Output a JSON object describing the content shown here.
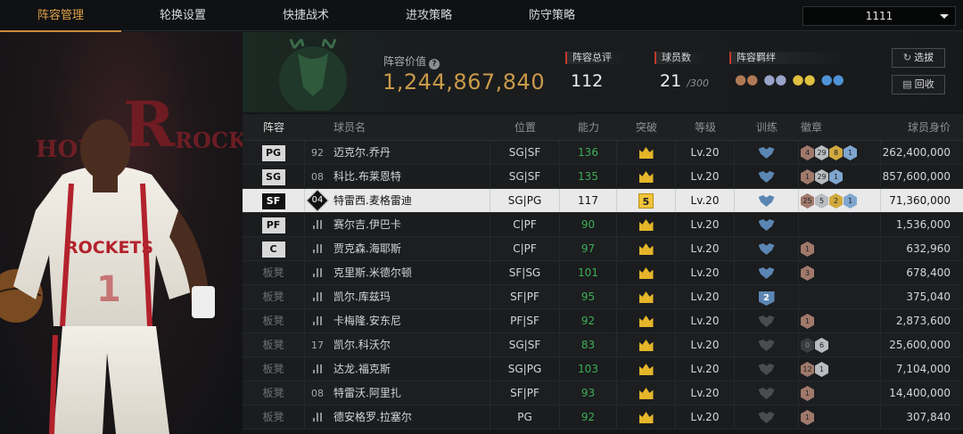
{
  "tabs": [
    {
      "label": "阵容管理",
      "active": true
    },
    {
      "label": "轮换设置",
      "active": false
    },
    {
      "label": "快捷战术",
      "active": false
    },
    {
      "label": "进攻策略",
      "active": false
    },
    {
      "label": "防守策略",
      "active": false
    }
  ],
  "dropdown": {
    "selected": "1111"
  },
  "header": {
    "value_label": "阵容价值",
    "value": "1,244,867,840",
    "rating_label": "阵容总评",
    "rating": "112",
    "count_label": "球员数",
    "count": "21",
    "count_max": "/300",
    "bond_label": "阵容羁绊",
    "select_button": "选拔",
    "recycle_button": "回收"
  },
  "table": {
    "columns": [
      "阵容",
      "球员名",
      "位置",
      "能力",
      "突破",
      "等级",
      "训练",
      "徽章",
      "球员身价"
    ],
    "rows": [
      {
        "slot": "PG",
        "starter": true,
        "num": "92",
        "name": "迈克尔.乔丹",
        "position": "SG|SF",
        "ability": "136",
        "ability_green": true,
        "breakthrough": "crown",
        "level": "Lv.20",
        "training": "blue",
        "badges": [
          {
            "t": "bronze",
            "v": "4"
          },
          {
            "t": "silver",
            "v": "29"
          },
          {
            "t": "gold",
            "v": "8"
          },
          {
            "t": "plat",
            "v": "1"
          }
        ],
        "value": "262,400,000"
      },
      {
        "slot": "SG",
        "starter": true,
        "num": "08",
        "name": "科比.布莱恩特",
        "position": "SG|SF",
        "ability": "135",
        "ability_green": true,
        "breakthrough": "crown",
        "level": "Lv.20",
        "training": "blue",
        "badges": [
          {
            "t": "bronze",
            "v": "1"
          },
          {
            "t": "silver",
            "v": "29"
          },
          {
            "t": "plat",
            "v": "1"
          }
        ],
        "value": "857,600,000"
      },
      {
        "slot": "SF",
        "starter": true,
        "selected": true,
        "num": "04",
        "name": "特雷西.麦格雷迪",
        "position": "SG|PG",
        "ability": "117",
        "ability_green": false,
        "breakthrough": "5",
        "level": "Lv.20",
        "training": "blue",
        "badges": [
          {
            "t": "bronze",
            "v": "25"
          },
          {
            "t": "silver",
            "v": "5"
          },
          {
            "t": "gold",
            "v": "2"
          },
          {
            "t": "plat",
            "v": "1"
          }
        ],
        "value": "71,360,000"
      },
      {
        "slot": "PF",
        "starter": true,
        "num": "",
        "name": "赛尔吉.伊巴卡",
        "position": "C|PF",
        "ability": "90",
        "ability_green": true,
        "breakthrough": "crown",
        "level": "Lv.20",
        "training": "blue",
        "badges": [],
        "value": "1,536,000"
      },
      {
        "slot": "C",
        "starter": true,
        "num": "",
        "name": "贾克森.海耶斯",
        "position": "C|PF",
        "ability": "97",
        "ability_green": true,
        "breakthrough": "crown",
        "level": "Lv.20",
        "training": "blue",
        "badges": [
          {
            "t": "bronze",
            "v": "1"
          }
        ],
        "value": "632,960"
      },
      {
        "slot": "板凳",
        "starter": false,
        "num": "",
        "name": "克里斯.米德尔顿",
        "position": "SF|SG",
        "ability": "101",
        "ability_green": true,
        "breakthrough": "crown",
        "level": "Lv.20",
        "training": "blue",
        "badges": [
          {
            "t": "bronze",
            "v": "3"
          }
        ],
        "value": "678,400"
      },
      {
        "slot": "板凳",
        "starter": false,
        "num": "",
        "name": "凯尔.库兹玛",
        "position": "SF|PF",
        "ability": "95",
        "ability_green": true,
        "breakthrough": "crown",
        "level": "Lv.20",
        "training": "2",
        "badges": [],
        "value": "375,040"
      },
      {
        "slot": "板凳",
        "starter": false,
        "num": "",
        "name": "卡梅隆.安东尼",
        "position": "PF|SF",
        "ability": "92",
        "ability_green": true,
        "breakthrough": "crown",
        "level": "Lv.20",
        "training": "grey",
        "badges": [
          {
            "t": "bronze",
            "v": "1"
          }
        ],
        "value": "2,873,600"
      },
      {
        "slot": "板凳",
        "starter": false,
        "num": "17",
        "name": "凯尔.科沃尔",
        "position": "SG|SF",
        "ability": "83",
        "ability_green": true,
        "breakthrough": "crown",
        "level": "Lv.20",
        "training": "grey",
        "badges": [
          {
            "t": "dark",
            "v": "0"
          },
          {
            "t": "silver",
            "v": "6"
          }
        ],
        "value": "25,600,000"
      },
      {
        "slot": "板凳",
        "starter": false,
        "num": "",
        "name": "达龙.福克斯",
        "position": "SG|PG",
        "ability": "103",
        "ability_green": true,
        "breakthrough": "crown",
        "level": "Lv.20",
        "training": "grey",
        "badges": [
          {
            "t": "bronze",
            "v": "12"
          },
          {
            "t": "silver",
            "v": "1"
          }
        ],
        "value": "7,104,000"
      },
      {
        "slot": "板凳",
        "starter": false,
        "num": "08",
        "name": "特雷沃.阿里扎",
        "position": "SF|PF",
        "ability": "93",
        "ability_green": true,
        "breakthrough": "crown",
        "level": "Lv.20",
        "training": "grey",
        "badges": [
          {
            "t": "bronze",
            "v": "1"
          }
        ],
        "value": "14,400,000"
      },
      {
        "slot": "板凳",
        "starter": false,
        "num": "",
        "name": "德安格罗.拉塞尔",
        "position": "PG",
        "ability": "92",
        "ability_green": true,
        "breakthrough": "crown",
        "level": "Lv.20",
        "training": "grey",
        "badges": [
          {
            "t": "bronze",
            "v": "1"
          }
        ],
        "value": "307,840"
      }
    ]
  },
  "colors": {
    "accent": "#e0a24a",
    "gold": "#c99a4a",
    "green": "#3fae55",
    "highlight_row": "#e9e9e9"
  }
}
